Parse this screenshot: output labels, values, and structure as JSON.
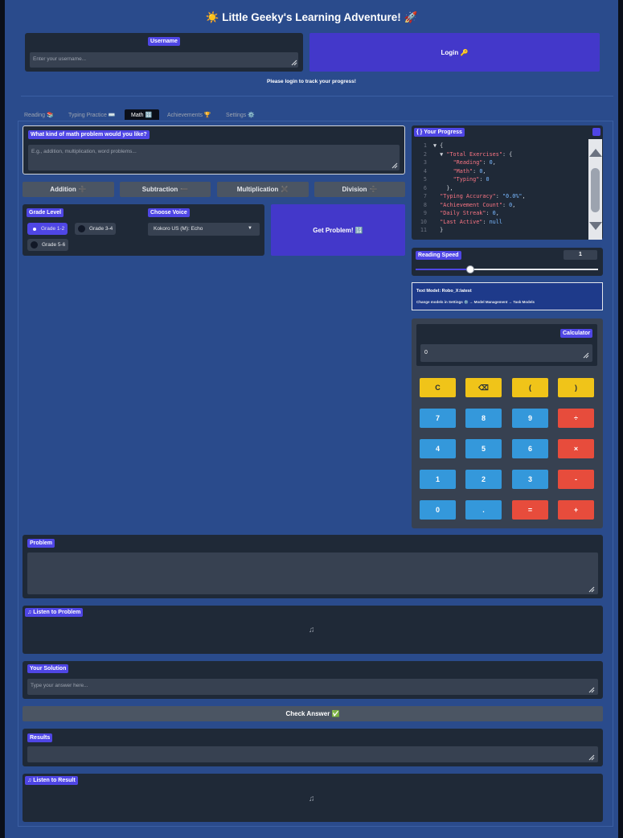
{
  "app": {
    "title": "☀️ Little Geeky's Learning Adventure! 🚀"
  },
  "login": {
    "username_label": "Username",
    "username_placeholder": "Enter your username...",
    "login_button": "Login 🔑",
    "status": "Please login to track your progress!"
  },
  "tabs": [
    "Reading 📚",
    "Typing Practice ⌨️",
    "Math 🔢",
    "Achievements 🏆",
    "Settings ⚙️"
  ],
  "active_tab": "Math 🔢",
  "math": {
    "prompt_label": "What kind of math problem would you like?",
    "prompt_placeholder": "E.g., addition, multiplication, word problems...",
    "ops": [
      {
        "label": "Addition",
        "icon": "➕"
      },
      {
        "label": "Subtraction",
        "icon": "➖"
      },
      {
        "label": "Multiplication",
        "icon": "✖️"
      },
      {
        "label": "Division",
        "icon": "➗"
      }
    ],
    "grade_label": "Grade Level",
    "grades": [
      "Grade 1-2",
      "Grade 3-4",
      "Grade 5-6"
    ],
    "selected_grade": "Grade 1-2",
    "voice_label": "Choose Voice",
    "voice_value": "Kokoro US (M): Echo",
    "get_problem": "Get Problem! 🔢",
    "problem_label": "Problem",
    "listen_problem_label": "♫ Listen to Problem",
    "solution_label": "Your Solution",
    "solution_placeholder": "Type your answer here...",
    "check_answer": "Check Answer ✅",
    "results_label": "Results",
    "listen_result_label": "♫ Listen to Result"
  },
  "progress": {
    "label": "{ } Your Progress",
    "lines": [
      {
        "n": "1",
        "text": "▼ {"
      },
      {
        "n": "2",
        "key": "\"Total Exercises\"",
        "suffix": ": {",
        "indent": 1,
        "arrow": true
      },
      {
        "n": "3",
        "key": "\"Reading\"",
        "value": "0",
        "indent": 3
      },
      {
        "n": "4",
        "key": "\"Math\"",
        "value": "0",
        "indent": 3
      },
      {
        "n": "5",
        "key": "\"Typing\"",
        "value": "0",
        "indent": 3,
        "last": true
      },
      {
        "n": "6",
        "text": "},",
        "indent": 2
      },
      {
        "n": "7",
        "key": "\"Typing Accuracy\"",
        "value": "\"0.0%\"",
        "indent": 1
      },
      {
        "n": "8",
        "key": "\"Achievement Count\"",
        "value": "0",
        "indent": 1
      },
      {
        "n": "9",
        "key": "\"Daily Streak\"",
        "value": "0",
        "indent": 1
      },
      {
        "n": "10",
        "key": "\"Last Active\"",
        "value": "null",
        "indent": 1,
        "last": true
      },
      {
        "n": "11",
        "text": "}",
        "indent": 1
      }
    ]
  },
  "reading_speed": {
    "label": "Reading Speed",
    "value": "1",
    "fraction": 0.3
  },
  "model_info": {
    "line1": "Text Model: Robo_X:latest",
    "line2": "Change models in Settings ⚙️ → Model Management → Task Models"
  },
  "calculator": {
    "label": "Calculator",
    "display": "0",
    "rows": [
      [
        {
          "k": "C",
          "c": "y"
        },
        {
          "k": "⌫",
          "c": "y"
        },
        {
          "k": "(",
          "c": "y"
        },
        {
          "k": ")",
          "c": "y"
        }
      ],
      [
        {
          "k": "7",
          "c": "b"
        },
        {
          "k": "8",
          "c": "b"
        },
        {
          "k": "9",
          "c": "b"
        },
        {
          "k": "÷",
          "c": "r"
        }
      ],
      [
        {
          "k": "4",
          "c": "b"
        },
        {
          "k": "5",
          "c": "b"
        },
        {
          "k": "6",
          "c": "b"
        },
        {
          "k": "×",
          "c": "r"
        }
      ],
      [
        {
          "k": "1",
          "c": "b"
        },
        {
          "k": "2",
          "c": "b"
        },
        {
          "k": "3",
          "c": "b"
        },
        {
          "k": "-",
          "c": "r"
        }
      ],
      [
        {
          "k": "0",
          "c": "b"
        },
        {
          "k": ".",
          "c": "b"
        },
        {
          "k": "=",
          "c": "r"
        },
        {
          "k": "+",
          "c": "r"
        }
      ]
    ]
  },
  "colors": {
    "accent": "#4f46e5",
    "page_bg": "#2a4b8c",
    "panel": "#1f2937",
    "field": "#374151"
  }
}
